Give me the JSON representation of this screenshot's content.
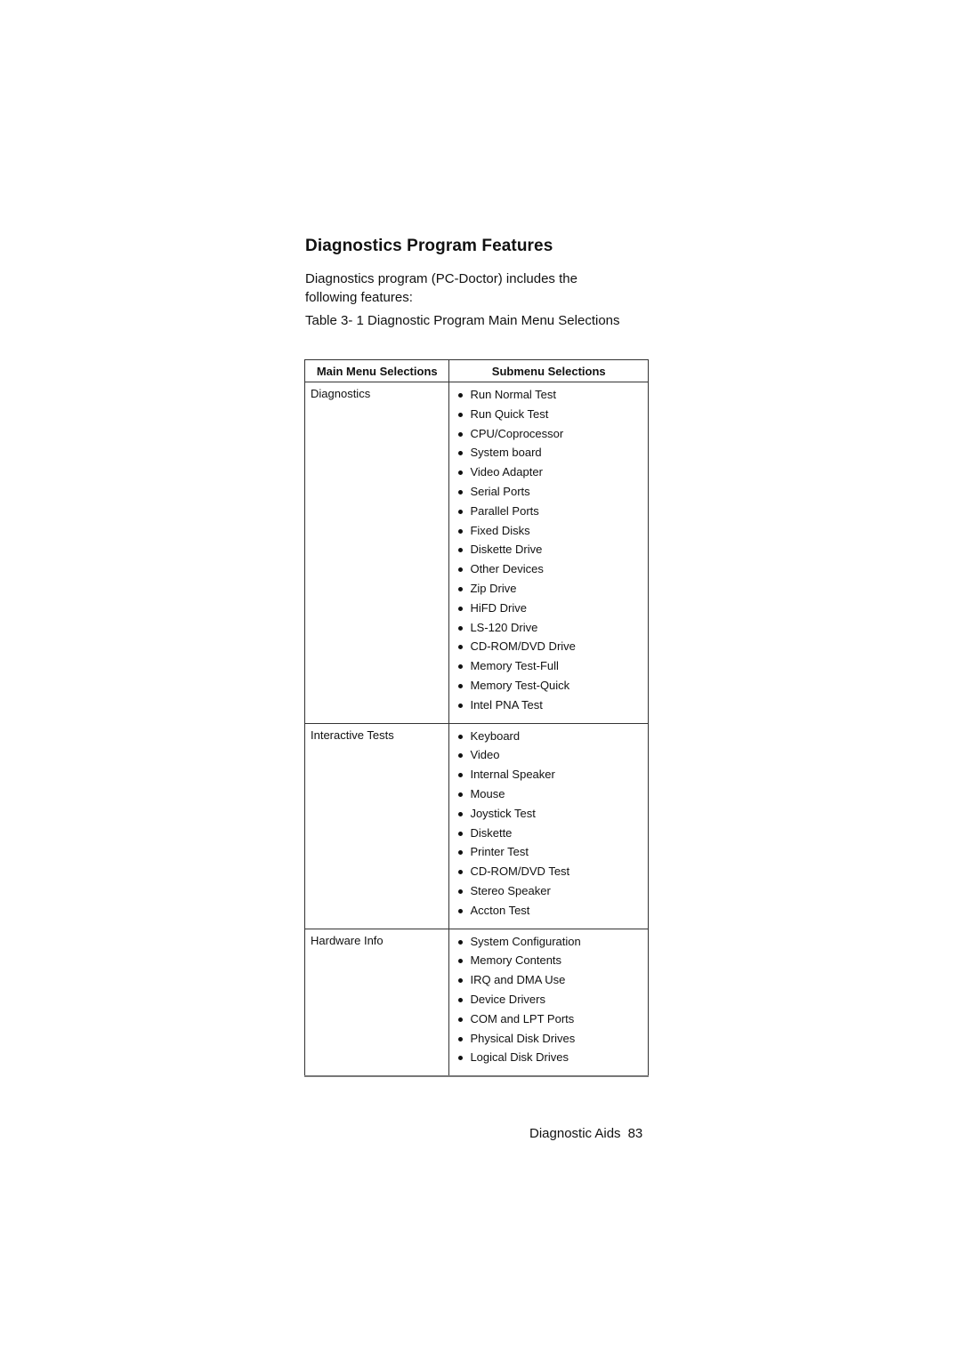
{
  "page": {
    "title": "Diagnostics Program Features",
    "intro": "Diagnostics program (PC-Doctor) includes the following features:",
    "caption": "Table 3- 1 Diagnostic Program Main Menu Selections"
  },
  "table": {
    "headers": {
      "main": "Main Menu Selections",
      "sub": "Submenu Selections"
    },
    "rows": [
      {
        "main": "Diagnostics",
        "items": [
          "Run Normal Test",
          "Run Quick Test",
          "CPU/Coprocessor",
          "System board",
          "Video Adapter",
          "Serial Ports",
          "Parallel Ports",
          "Fixed Disks",
          "Diskette Drive",
          "Other Devices",
          "Zip Drive",
          "HiFD Drive",
          "LS-120 Drive",
          "CD-ROM/DVD Drive",
          "Memory Test-Full",
          "Memory Test-Quick",
          "Intel PNA Test"
        ]
      },
      {
        "main": "Interactive Tests",
        "items": [
          "Keyboard",
          "Video",
          "Internal Speaker",
          "Mouse",
          "Joystick Test",
          "Diskette",
          "Printer Test",
          "CD-ROM/DVD Test",
          "Stereo Speaker",
          "Accton Test"
        ]
      },
      {
        "main": "Hardware Info",
        "items": [
          "System Configuration",
          "Memory Contents",
          "IRQ and DMA Use",
          "Device Drivers",
          "COM and LPT Ports",
          "Physical Disk Drives",
          "Logical Disk Drives"
        ]
      }
    ]
  },
  "footer": {
    "section": "Diagnostic Aids",
    "page_number": "83"
  }
}
